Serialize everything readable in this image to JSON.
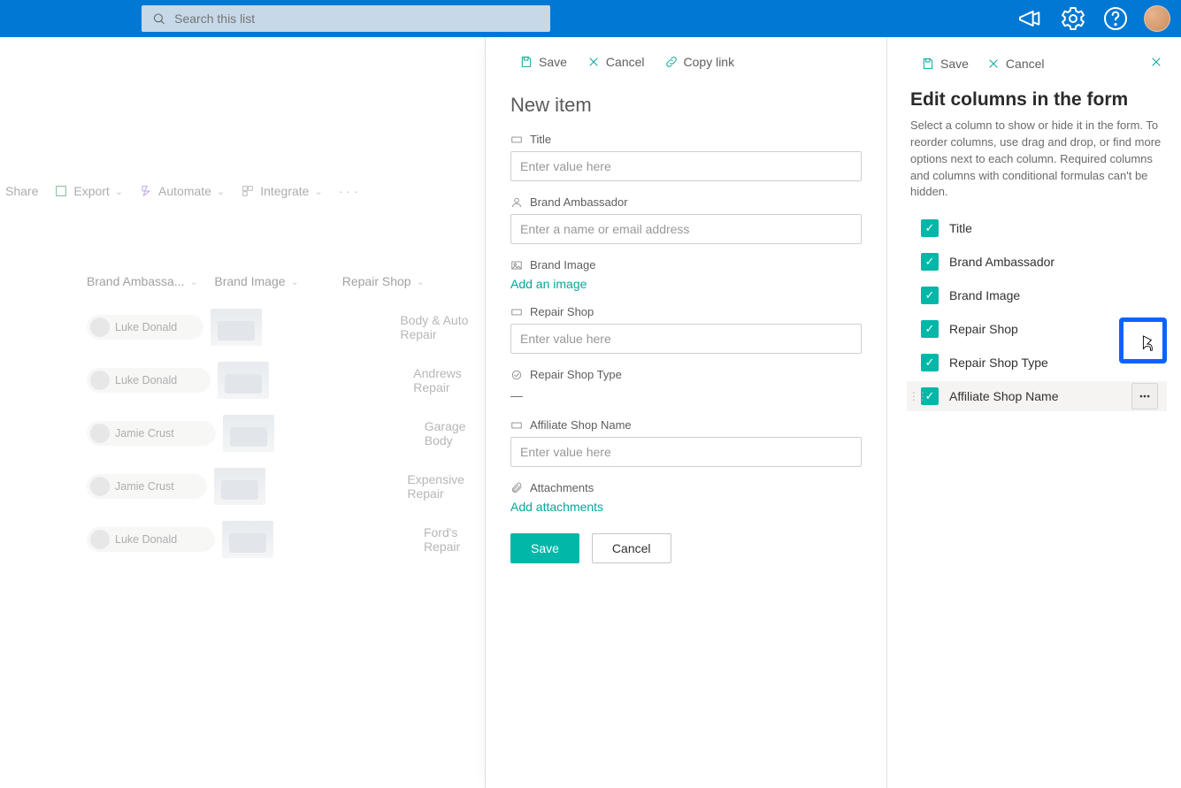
{
  "header": {
    "search_placeholder": "Search this list"
  },
  "commands": {
    "share": "Share",
    "export": "Export",
    "automate": "Automate",
    "integrate": "Integrate"
  },
  "list": {
    "columns": {
      "ambassador": "Brand Ambassa...",
      "image": "Brand Image",
      "shop": "Repair Shop"
    },
    "rows": [
      {
        "ambassador": "Luke Donald",
        "shop": "Body & Auto Repair"
      },
      {
        "ambassador": "Luke Donald",
        "shop": "Andrews Repair"
      },
      {
        "ambassador": "Jamie Crust",
        "shop": "Garage Body"
      },
      {
        "ambassador": "Jamie Crust",
        "shop": "Expensive Repair"
      },
      {
        "ambassador": "Luke Donald",
        "shop": "Ford's Repair"
      }
    ]
  },
  "newItem": {
    "cmd": {
      "save": "Save",
      "cancel": "Cancel",
      "copy": "Copy link"
    },
    "heading": "New item",
    "fields": {
      "title": {
        "label": "Title",
        "placeholder": "Enter value here"
      },
      "ambassador": {
        "label": "Brand Ambassador",
        "placeholder": "Enter a name or email address"
      },
      "image": {
        "label": "Brand Image",
        "action": "Add an image"
      },
      "shop": {
        "label": "Repair Shop",
        "placeholder": "Enter value here"
      },
      "shoptype": {
        "label": "Repair Shop Type",
        "value": "—"
      },
      "affiliate": {
        "label": "Affiliate Shop Name",
        "placeholder": "Enter value here"
      },
      "attach": {
        "label": "Attachments",
        "action": "Add attachments"
      }
    },
    "save_btn": "Save",
    "cancel_btn": "Cancel"
  },
  "editColumns": {
    "cmd": {
      "save": "Save",
      "cancel": "Cancel"
    },
    "heading": "Edit columns in the form",
    "desc": "Select a column to show or hide it in the form. To reorder columns, use drag and drop, or find more options next to each column. Required columns and columns with conditional formulas can't be hidden.",
    "items": [
      {
        "label": "Title"
      },
      {
        "label": "Brand Ambassador"
      },
      {
        "label": "Brand Image"
      },
      {
        "label": "Repair Shop"
      },
      {
        "label": "Repair Shop Type"
      },
      {
        "label": "Affiliate Shop Name"
      }
    ]
  }
}
